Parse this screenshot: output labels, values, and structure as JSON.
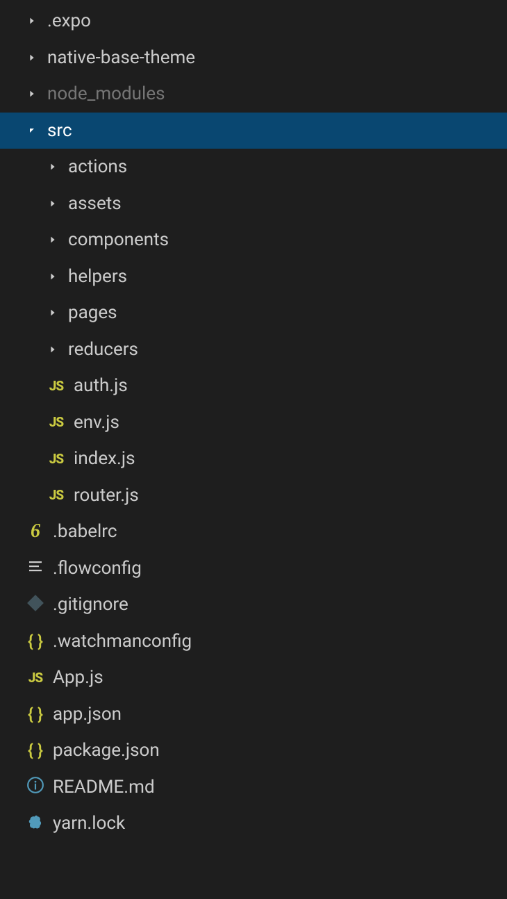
{
  "tree": {
    "items": [
      {
        "label": ".expo",
        "type": "folder",
        "expanded": false,
        "depth": 0,
        "selected": false,
        "dimmed": false,
        "icon": "chevron-right"
      },
      {
        "label": "native-base-theme",
        "type": "folder",
        "expanded": false,
        "depth": 0,
        "selected": false,
        "dimmed": false,
        "icon": "chevron-right"
      },
      {
        "label": "node_modules",
        "type": "folder",
        "expanded": false,
        "depth": 0,
        "selected": false,
        "dimmed": true,
        "icon": "chevron-right"
      },
      {
        "label": "src",
        "type": "folder",
        "expanded": true,
        "depth": 0,
        "selected": true,
        "dimmed": false,
        "icon": "chevron-down"
      },
      {
        "label": "actions",
        "type": "folder",
        "expanded": false,
        "depth": 1,
        "selected": false,
        "dimmed": false,
        "icon": "chevron-right"
      },
      {
        "label": "assets",
        "type": "folder",
        "expanded": false,
        "depth": 1,
        "selected": false,
        "dimmed": false,
        "icon": "chevron-right"
      },
      {
        "label": "components",
        "type": "folder",
        "expanded": false,
        "depth": 1,
        "selected": false,
        "dimmed": false,
        "icon": "chevron-right"
      },
      {
        "label": "helpers",
        "type": "folder",
        "expanded": false,
        "depth": 1,
        "selected": false,
        "dimmed": false,
        "icon": "chevron-right"
      },
      {
        "label": "pages",
        "type": "folder",
        "expanded": false,
        "depth": 1,
        "selected": false,
        "dimmed": false,
        "icon": "chevron-right"
      },
      {
        "label": "reducers",
        "type": "folder",
        "expanded": false,
        "depth": 1,
        "selected": false,
        "dimmed": false,
        "icon": "chevron-right"
      },
      {
        "label": "auth.js",
        "type": "file",
        "depth": 1,
        "selected": false,
        "dimmed": false,
        "icon": "js"
      },
      {
        "label": "env.js",
        "type": "file",
        "depth": 1,
        "selected": false,
        "dimmed": false,
        "icon": "js"
      },
      {
        "label": "index.js",
        "type": "file",
        "depth": 1,
        "selected": false,
        "dimmed": false,
        "icon": "js"
      },
      {
        "label": "router.js",
        "type": "file",
        "depth": 1,
        "selected": false,
        "dimmed": false,
        "icon": "js"
      },
      {
        "label": ".babelrc",
        "type": "file",
        "depth": 0,
        "selected": false,
        "dimmed": false,
        "icon": "babel"
      },
      {
        "label": ".flowconfig",
        "type": "file",
        "depth": 0,
        "selected": false,
        "dimmed": false,
        "icon": "flow"
      },
      {
        "label": ".gitignore",
        "type": "file",
        "depth": 0,
        "selected": false,
        "dimmed": false,
        "icon": "git"
      },
      {
        "label": ".watchmanconfig",
        "type": "file",
        "depth": 0,
        "selected": false,
        "dimmed": false,
        "icon": "json"
      },
      {
        "label": "App.js",
        "type": "file",
        "depth": 0,
        "selected": false,
        "dimmed": false,
        "icon": "js"
      },
      {
        "label": "app.json",
        "type": "file",
        "depth": 0,
        "selected": false,
        "dimmed": false,
        "icon": "json"
      },
      {
        "label": "package.json",
        "type": "file",
        "depth": 0,
        "selected": false,
        "dimmed": false,
        "icon": "json"
      },
      {
        "label": "README.md",
        "type": "file",
        "depth": 0,
        "selected": false,
        "dimmed": false,
        "icon": "info"
      },
      {
        "label": "yarn.lock",
        "type": "file",
        "depth": 0,
        "selected": false,
        "dimmed": false,
        "icon": "yarn"
      }
    ]
  },
  "iconText": {
    "js": "JS",
    "json": "{ }",
    "babel": "6"
  }
}
